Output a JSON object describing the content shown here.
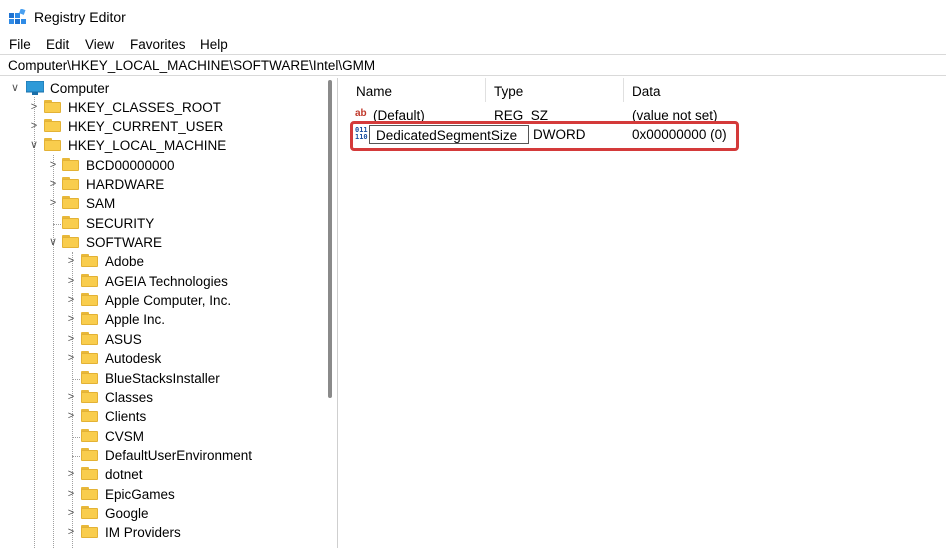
{
  "window": {
    "title": "Registry Editor",
    "app_icon": "registry-editor-icon"
  },
  "menu": [
    "File",
    "Edit",
    "View",
    "Favorites",
    "Help"
  ],
  "address_bar": {
    "path": "Computer\\HKEY_LOCAL_MACHINE\\SOFTWARE\\Intel\\GMM"
  },
  "tree": {
    "root": "Computer",
    "items": [
      {
        "label": "HKEY_CLASSES_ROOT",
        "expanded": false
      },
      {
        "label": "HKEY_CURRENT_USER",
        "expanded": false
      },
      {
        "label": "HKEY_LOCAL_MACHINE",
        "expanded": true
      },
      {
        "label": "BCD00000000",
        "expanded": false
      },
      {
        "label": "HARDWARE",
        "expanded": false
      },
      {
        "label": "SAM",
        "expanded": false
      },
      {
        "label": "SECURITY",
        "expanded": null
      },
      {
        "label": "SOFTWARE",
        "expanded": true
      },
      {
        "label": "Adobe",
        "expanded": false
      },
      {
        "label": "AGEIA Technologies",
        "expanded": false
      },
      {
        "label": "Apple Computer, Inc.",
        "expanded": false
      },
      {
        "label": "Apple Inc.",
        "expanded": false
      },
      {
        "label": "ASUS",
        "expanded": false
      },
      {
        "label": "Autodesk",
        "expanded": false
      },
      {
        "label": "BlueStacksInstaller",
        "expanded": null
      },
      {
        "label": "Classes",
        "expanded": false
      },
      {
        "label": "Clients",
        "expanded": false
      },
      {
        "label": "CVSM",
        "expanded": null
      },
      {
        "label": "DefaultUserEnvironment",
        "expanded": null
      },
      {
        "label": "dotnet",
        "expanded": false
      },
      {
        "label": "EpicGames",
        "expanded": false
      },
      {
        "label": "Google",
        "expanded": false
      },
      {
        "label": "IM Providers",
        "expanded": false
      }
    ]
  },
  "list": {
    "columns": [
      "Name",
      "Type",
      "Data"
    ],
    "rows": [
      {
        "name": "(Default)",
        "type": "REG_SZ",
        "data": "(value not set)",
        "icon": "string-value-icon"
      },
      {
        "name": "DedicatedSegmentSize",
        "type": "DWORD",
        "data": "0x00000000 (0)",
        "icon": "binary-value-icon",
        "editing": true
      }
    ]
  },
  "colors": {
    "highlight": "#d43a3a",
    "folder": "#f9cd4d"
  }
}
